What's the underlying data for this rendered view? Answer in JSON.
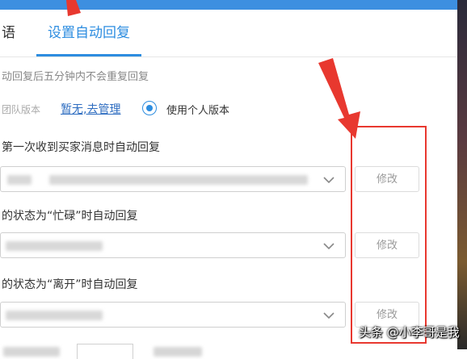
{
  "tabs": [
    {
      "label": "语"
    },
    {
      "label": "设置自动回复",
      "active": true
    }
  ],
  "note": "动回复后五分钟内不会重复回复",
  "version": {
    "team_label": "团队版本",
    "team_link": "暂无,去管理",
    "personal_label": "使用个人版本",
    "selected": "personal"
  },
  "rules": [
    {
      "label": "第一次收到买家消息时自动回复",
      "value": "",
      "button": "修改"
    },
    {
      "label": "的状态为“忙碌”时自动回复",
      "value": "",
      "button": "修改"
    },
    {
      "label": "的状态为“离开”时自动回复",
      "value": "",
      "button": "修改"
    }
  ],
  "watermark": "头条 @小李哥是我",
  "colors": {
    "accent": "#2d8de0",
    "link": "#2d6cc0",
    "highlight": "#e8382f",
    "topbar": "#3d8fe0"
  }
}
